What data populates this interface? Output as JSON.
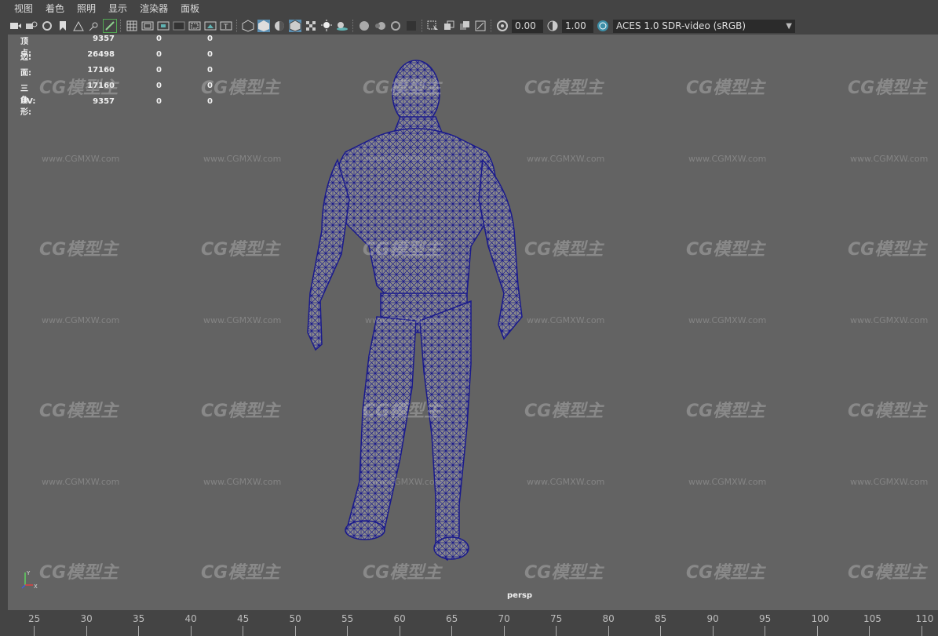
{
  "menu": [
    "视图",
    "着色",
    "照明",
    "显示",
    "渲染器",
    "面板"
  ],
  "toolbar": {
    "exposure": "0.00",
    "gamma": "1.00",
    "color_space": "ACES 1.0 SDR-video (sRGB)"
  },
  "hud": {
    "rows": [
      {
        "label": "顶点:",
        "v1": "9357",
        "v2": "0",
        "v3": "0"
      },
      {
        "label": "边:",
        "v1": "26498",
        "v2": "0",
        "v3": "0"
      },
      {
        "label": "面:",
        "v1": "17160",
        "v2": "0",
        "v3": "0"
      },
      {
        "label": "三角形:",
        "v1": "17160",
        "v2": "0",
        "v3": "0"
      },
      {
        "label": "UV:",
        "v1": "9357",
        "v2": "0",
        "v3": "0"
      }
    ]
  },
  "camera_label": "persp",
  "axis": {
    "y": "Y",
    "x": "X"
  },
  "watermark": {
    "logo": "CG模型主",
    "url": "www.CGMXW.com"
  },
  "timeline": {
    "ticks": [
      "25",
      "30",
      "35",
      "40",
      "45",
      "50",
      "55",
      "60",
      "65",
      "70",
      "75",
      "80",
      "85",
      "90",
      "95",
      "100",
      "105",
      "110"
    ]
  },
  "colors": {
    "wireframe": "#1a1a8c",
    "viewport": "#636363",
    "ui": "#444444",
    "accent": "#5a8db0"
  }
}
